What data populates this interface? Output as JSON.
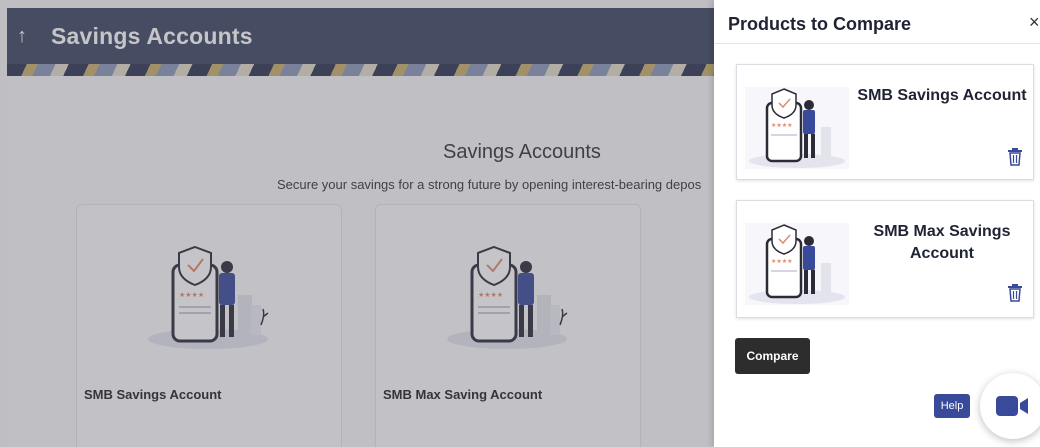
{
  "header": {
    "title": "Savings Accounts",
    "back_icon": "arrow-up-icon"
  },
  "section": {
    "title": "Savings Accounts",
    "subtitle": "Secure your savings for a strong future by opening interest-bearing depos"
  },
  "cards": [
    {
      "name": "SMB Savings Account"
    },
    {
      "name": "SMB Max Saving Account"
    }
  ],
  "compare_panel": {
    "title": "Products to Compare",
    "close_label": "×",
    "products": [
      {
        "name": "SMB Savings Account"
      },
      {
        "name": "SMB Max Savings Account"
      }
    ],
    "compare_label": "Compare",
    "help_label": "Help"
  },
  "colors": {
    "header_bg": "#3d4560",
    "accent": "#3a4a9a",
    "button_dark": "#2d2d2d"
  }
}
